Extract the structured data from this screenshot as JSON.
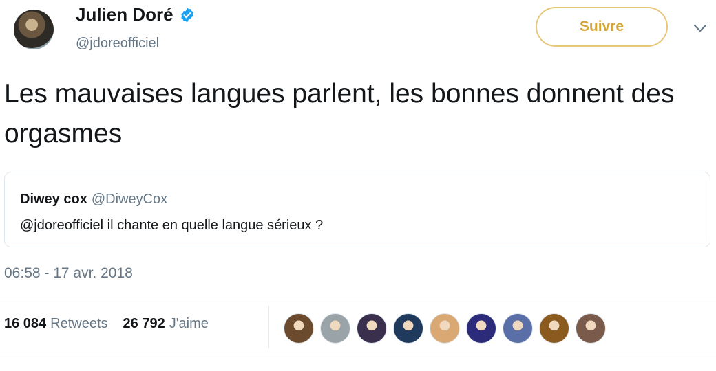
{
  "author": {
    "display_name": "Julien Doré",
    "handle": "@jdoreofficiel",
    "verified": true
  },
  "follow_button": {
    "label": "Suivre"
  },
  "menu_icon": "chevron-down-icon",
  "tweet": {
    "text": "Les mauvaises langues parlent, les bonnes donnent des orgasmes",
    "timestamp": "06:58 - 17 avr. 2018"
  },
  "quoted_tweet": {
    "name": "Diwey cox",
    "handle": "@DiweyCox",
    "text": "@jdoreofficiel il chante en quelle langue sérieux ?"
  },
  "stats": {
    "retweets_count": "16 084",
    "retweets_label": "Retweets",
    "likes_count": "26 792",
    "likes_label": "J'aime"
  },
  "colors": {
    "follow_accent": "#d6a53a",
    "verified_blue": "#1da1f2",
    "secondary_text": "#657786"
  },
  "liker_avatars": [
    {
      "color": "#6b4a2e"
    },
    {
      "color": "#9aa3a8"
    },
    {
      "color": "#3a2f4d"
    },
    {
      "color": "#1f3a5c"
    },
    {
      "color": "#d9a873"
    },
    {
      "color": "#2b2b7a"
    },
    {
      "color": "#5a6fa8"
    },
    {
      "color": "#8a5a1f"
    },
    {
      "color": "#7a5a4a"
    }
  ]
}
